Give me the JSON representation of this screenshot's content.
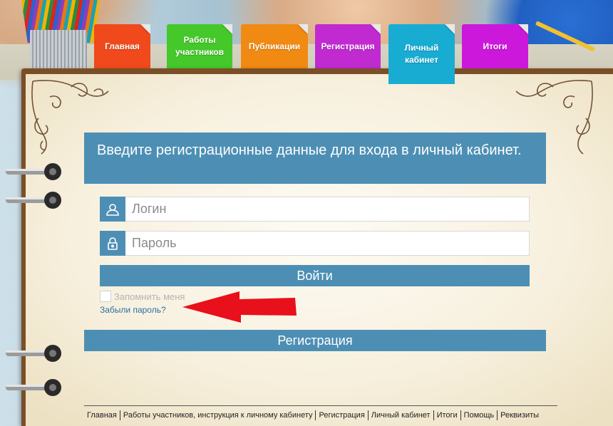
{
  "nav": {
    "tabs": [
      {
        "label_lines": [
          "Главная"
        ],
        "color": "#f0491c"
      },
      {
        "label_lines": [
          "Работы",
          "участников"
        ],
        "color": "#44c82a"
      },
      {
        "label_lines": [
          "Публикации"
        ],
        "color": "#f08a12"
      },
      {
        "label_lines": [
          "Регистрация"
        ],
        "color": "#c12ad1"
      },
      {
        "label_lines": [
          "Личный",
          "кабинет"
        ],
        "color": "#18acd2",
        "active": true
      },
      {
        "label_lines": [
          "Итоги"
        ],
        "color": "#cc18da"
      }
    ]
  },
  "login": {
    "heading": "Введите регистрационные данные для входа в личный кабинет.",
    "login_placeholder": "Логин",
    "password_placeholder": "Пароль",
    "submit_label": "Войти",
    "remember_label": "Запомнить меня",
    "forgot_label": "Забыли пароль?",
    "register_label": "Регистрация",
    "user_icon": "user-icon",
    "lock_icon": "lock-icon"
  },
  "footer": {
    "links": [
      "Главная",
      "Работы участников, инструкция к личному кабинету",
      "Регистрация",
      "Личный кабинет",
      "Итоги",
      "Помощь",
      "Реквизиты"
    ]
  },
  "colors": {
    "accent": "#4d8fb4",
    "arrow": "#e8101a",
    "notebook_frame": "#7a4f26"
  }
}
